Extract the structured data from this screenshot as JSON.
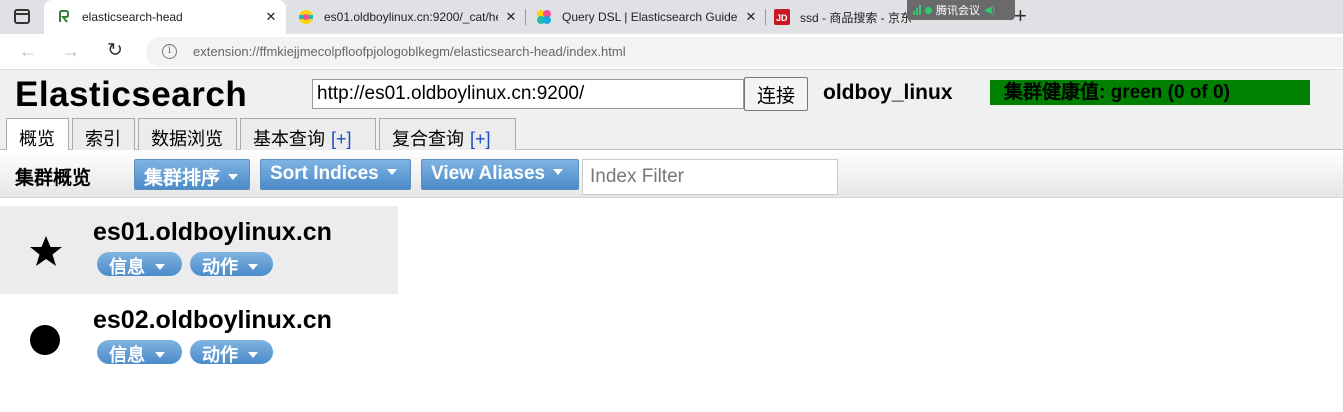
{
  "browser": {
    "tabs": [
      {
        "title": "elasticsearch-head",
        "favicon": "elasticsearch-head-icon",
        "close": "✕"
      },
      {
        "title": "es01.oldboylinux.cn:9200/_cat/he",
        "favicon": "elastic-icon",
        "close": "✕"
      },
      {
        "title": "Query DSL | Elasticsearch Guide |",
        "favicon": "elastic-guide-icon",
        "close": "✕"
      },
      {
        "title": "ssd - 商品搜索 - 京东",
        "favicon": "jd-icon",
        "close": "✕"
      }
    ],
    "meeting_label": "腾讯会议",
    "new_tab": "+",
    "nav": {
      "back": "←",
      "forward": "→",
      "reload": "↻"
    },
    "address": "extension://ffmkiejjmecolpfloofpjologoblkegm/elasticsearch-head/index.html",
    "info_glyph": "i"
  },
  "header": {
    "brand": "Elasticsearch",
    "connect_url": "http://es01.oldboylinux.cn:9200/",
    "connect_label": "连接",
    "cluster_name": "oldboy_linux",
    "health_text": "集群健康值: green (0 of 0)",
    "health_color": "#008000"
  },
  "tabs": [
    {
      "label": "概览",
      "plus": ""
    },
    {
      "label": "索引",
      "plus": ""
    },
    {
      "label": "数据浏览",
      "plus": ""
    },
    {
      "label": "基本查询",
      "plus": "[+]"
    },
    {
      "label": "复合查询",
      "plus": "[+]"
    }
  ],
  "toolbar": {
    "title": "集群概览",
    "sort_cluster": "集群排序",
    "sort_indices": "Sort Indices",
    "view_aliases": "View Aliases",
    "filter_placeholder": "Index Filter"
  },
  "nodes": [
    {
      "name": "es01.oldboylinux.cn",
      "role_icon": "star-icon",
      "info_label": "信息",
      "action_label": "动作",
      "master": true
    },
    {
      "name": "es02.oldboylinux.cn",
      "role_icon": "circle-icon",
      "info_label": "信息",
      "action_label": "动作",
      "master": false
    }
  ],
  "colors": {
    "button_blue": "#4b8bc8",
    "health_green": "#008000"
  }
}
